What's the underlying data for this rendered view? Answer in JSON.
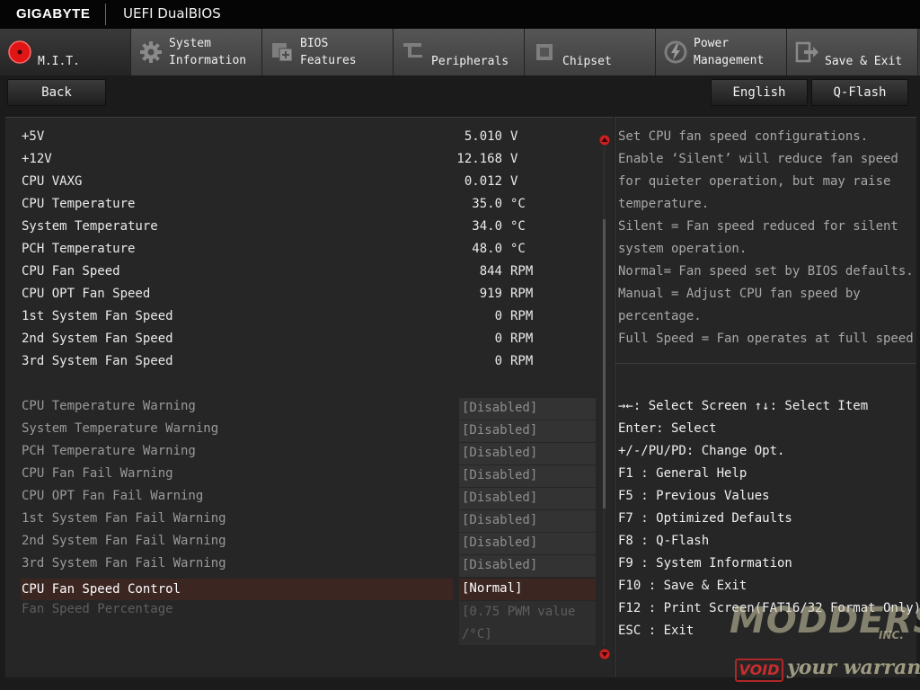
{
  "titlebar": {
    "brand": "GIGABYTE",
    "product": "UEFI DualBIOS"
  },
  "tabs": [
    {
      "label": "M.I.T.",
      "icon": "mit-icon",
      "active": true
    },
    {
      "label": "System\nInformation",
      "icon": "gear-icon"
    },
    {
      "label": "BIOS\nFeatures",
      "icon": "chip-plus-icon"
    },
    {
      "label": "Peripherals",
      "icon": "peripherals-icon"
    },
    {
      "label": "Chipset",
      "icon": "chipset-icon"
    },
    {
      "label": "Power\nManagement",
      "icon": "power-icon"
    },
    {
      "label": "Save & Exit",
      "icon": "exit-icon"
    }
  ],
  "toolbar": {
    "back": "Back",
    "language": "English",
    "qflash": "Q-Flash"
  },
  "monitor": [
    {
      "label": "+5V",
      "value": "5.010",
      "unit": "V"
    },
    {
      "label": "+12V",
      "value": "12.168",
      "unit": "V"
    },
    {
      "label": "CPU VAXG",
      "value": "0.012",
      "unit": "V"
    },
    {
      "label": "CPU Temperature",
      "value": "35.0",
      "unit": "°C"
    },
    {
      "label": "System Temperature",
      "value": "34.0",
      "unit": "°C"
    },
    {
      "label": "PCH Temperature",
      "value": "48.0",
      "unit": "°C"
    },
    {
      "label": "CPU Fan Speed",
      "value": "844",
      "unit": "RPM"
    },
    {
      "label": "CPU OPT Fan Speed",
      "value": "919",
      "unit": "RPM"
    },
    {
      "label": "1st System Fan Speed",
      "value": "0",
      "unit": "RPM"
    },
    {
      "label": "2nd System Fan Speed",
      "value": "0",
      "unit": "RPM"
    },
    {
      "label": "3rd System Fan Speed",
      "value": "0",
      "unit": "RPM"
    }
  ],
  "warnings": [
    {
      "label": "CPU Temperature Warning",
      "value": "[Disabled]"
    },
    {
      "label": "System Temperature Warning",
      "value": "[Disabled]"
    },
    {
      "label": "PCH Temperature Warning",
      "value": "[Disabled]"
    },
    {
      "label": "CPU Fan Fail Warning",
      "value": "[Disabled]"
    },
    {
      "label": "CPU OPT Fan Fail Warning",
      "value": "[Disabled]"
    },
    {
      "label": "1st System Fan Fail Warning",
      "value": "[Disabled]"
    },
    {
      "label": "2nd System Fan Fail Warning",
      "value": "[Disabled]"
    },
    {
      "label": "3rd System Fan Fail Warning",
      "value": "[Disabled]"
    }
  ],
  "fan_control": {
    "label": "CPU Fan Speed Control",
    "value": "[Normal]"
  },
  "fan_percentage": {
    "label": "Fan Speed Percentage",
    "value_line1": "[0.75 PWM value",
    "value_line2": "/°C]"
  },
  "help": [
    "Set CPU fan speed configurations.",
    "Enable ‘Silent’ will reduce fan speed",
    "for quieter operation, but may raise",
    "temperature.",
    "Silent = Fan speed reduced for silent",
    "system operation.",
    "Normal= Fan speed set by BIOS defaults.",
    "Manual = Adjust CPU fan speed by",
    "percentage.",
    "Full Speed = Fan operates at full speed"
  ],
  "keys": [
    "→←: Select Screen  ↑↓: Select Item",
    "Enter: Select",
    "+/-/PU/PD: Change Opt.",
    "F1  : General Help",
    "F5  : Previous Values",
    "F7  : Optimized Defaults",
    "F8  : Q-Flash",
    "F9  : System Information",
    "F10 : Save & Exit",
    "F12 : Print Screen(FAT16/32 Format Only)",
    "ESC : Exit"
  ],
  "watermark": {
    "modders": "MODDERS",
    "inc": "INC.",
    "void": "VOID",
    "tagline": "your warranty"
  },
  "colors": {
    "selected_row": "#3c2622",
    "scroll_arrow": "#cc2020",
    "mit_icon": "#e01515"
  }
}
